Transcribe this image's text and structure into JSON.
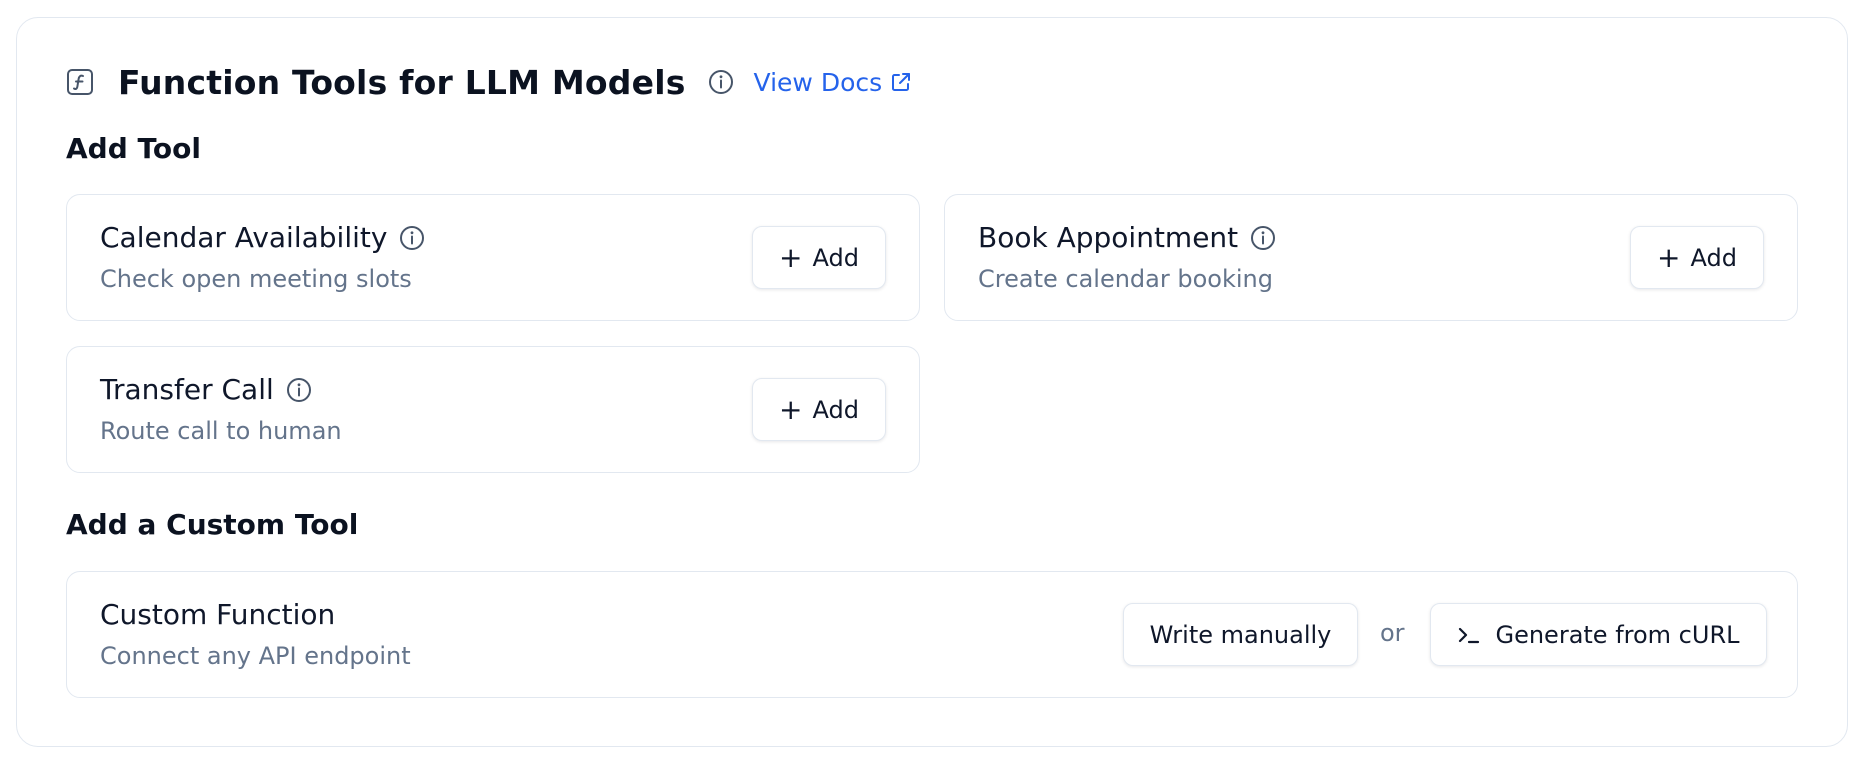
{
  "header": {
    "title": "Function Tools for LLM Models",
    "docs_link": "View Docs",
    "icon": "function-icon",
    "info_icon": "info-icon",
    "external_icon": "external-link-icon"
  },
  "sections": {
    "add_tool": "Add Tool",
    "custom_tool": "Add a Custom Tool"
  },
  "tools": [
    {
      "name": "Calendar Availability",
      "description": "Check open meeting slots",
      "button": "Add"
    },
    {
      "name": "Book Appointment",
      "description": "Create calendar booking",
      "button": "Add"
    },
    {
      "name": "Transfer Call",
      "description": "Route call to human",
      "button": "Add"
    }
  ],
  "custom": {
    "name": "Custom Function",
    "description": "Connect any API endpoint",
    "write_button": "Write manually",
    "or": "or",
    "curl_button": "Generate from cURL",
    "curl_icon": "terminal-icon"
  },
  "colors": {
    "link": "#2563eb",
    "muted_text": "#64748b",
    "border": "#e2e8f0"
  }
}
